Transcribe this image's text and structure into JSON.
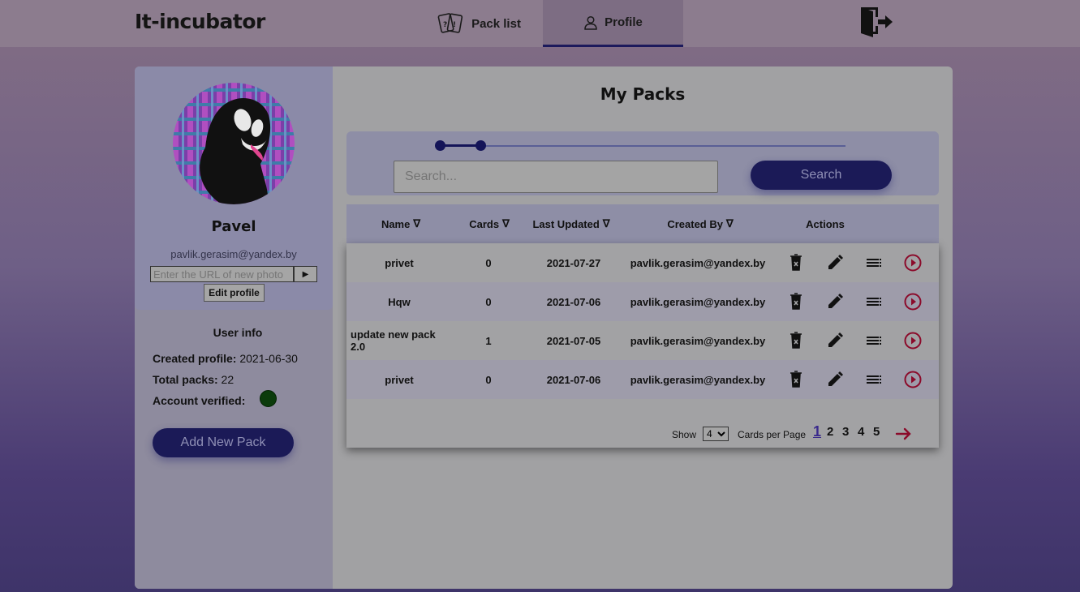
{
  "header": {
    "logo": "It-incubator",
    "tabs": [
      {
        "label": "Pack list",
        "icon": "cards-icon"
      },
      {
        "label": "Profile",
        "icon": "user-icon"
      }
    ],
    "active_tab": "Profile",
    "logout_icon": "logout-icon"
  },
  "profile": {
    "name": "Pavel",
    "email": "pavlik.gerasim@yandex.by",
    "photo_url_placeholder": "Enter the URL of new photo",
    "submit_glyph": "▶",
    "edit_label": "Edit profile"
  },
  "user_info": {
    "title": "User info",
    "created_label": "Created profile:",
    "created_value": "2021-06-30",
    "packs_label": "Total packs:",
    "packs_value": "22",
    "verified_label": "Account verified:",
    "verified_color": "#0b3b0b"
  },
  "add_pack_label": "Add New Pack",
  "main": {
    "title": "My Packs",
    "slider": {
      "min": 0,
      "max": 10
    },
    "search_placeholder": "Search...",
    "search_button": "Search"
  },
  "table": {
    "columns": [
      "Name",
      "Cards",
      "Last Updated",
      "Created By",
      "Actions"
    ],
    "sort_glyph": "∇",
    "rows": [
      {
        "name": "privet",
        "cards": "0",
        "updated": "2021-07-27",
        "created_by": "pavlik.gerasim@yandex.by"
      },
      {
        "name": "Hqw",
        "cards": "0",
        "updated": "2021-07-06",
        "created_by": "pavlik.gerasim@yandex.by"
      },
      {
        "name": "update new pack 2.0",
        "cards": "1",
        "updated": "2021-07-05",
        "created_by": "pavlik.gerasim@yandex.by"
      },
      {
        "name": "privet",
        "cards": "0",
        "updated": "2021-07-06",
        "created_by": "pavlik.gerasim@yandex.by"
      }
    ],
    "action_icons": [
      "delete-icon",
      "edit-icon",
      "list-icon",
      "play-icon"
    ]
  },
  "pagination": {
    "show_label": "Show",
    "per_page_value": "4",
    "per_page_label": "Cards per Page",
    "pages": [
      "1",
      "2",
      "3",
      "4",
      "5"
    ],
    "current_page": "1"
  },
  "colors": {
    "accent": "#1b1a57",
    "play": "#8b0a2a",
    "arrow": "#8b0a2a"
  }
}
